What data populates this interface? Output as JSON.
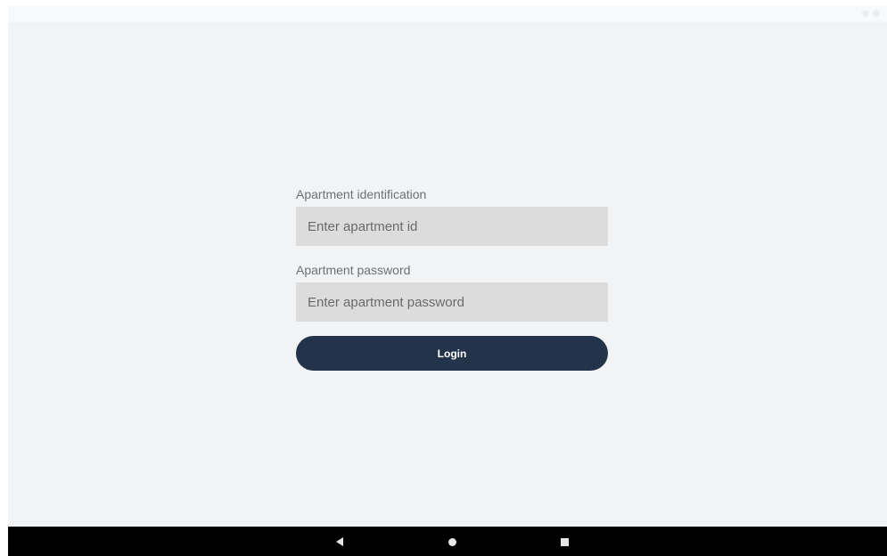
{
  "status_bar": {
    "icons": [
      "signal-icon",
      "battery-icon"
    ]
  },
  "login_form": {
    "apartment_id": {
      "label": "Apartment identification",
      "placeholder": "Enter apartment id",
      "value": ""
    },
    "apartment_password": {
      "label": "Apartment password",
      "placeholder": "Enter apartment password",
      "value": ""
    },
    "login_label": "Login"
  },
  "nav_bar": {
    "icons": [
      "back-icon",
      "home-icon",
      "recents-icon"
    ]
  },
  "colors": {
    "background": "#f2f3f5",
    "input_background": "#dcdcdc",
    "button_background": "#233349",
    "button_text": "#ffffff",
    "label_text": "#6d7078",
    "nav_bar": "#000000"
  }
}
